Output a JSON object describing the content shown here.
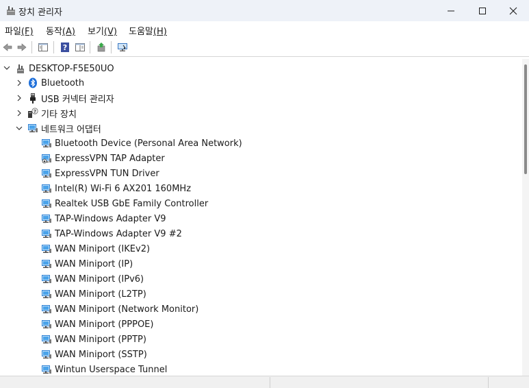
{
  "window": {
    "title": "장치 관리자",
    "icon": "device-manager-icon"
  },
  "controls": {
    "minimize_icon": "minimize-icon",
    "maximize_icon": "maximize-icon",
    "close_icon": "close-icon"
  },
  "menu": {
    "file": {
      "text": "파일",
      "accel": "(F)"
    },
    "action": {
      "text": "동작",
      "accel": "(A)"
    },
    "view": {
      "text": "보기",
      "accel": "(V)"
    },
    "help": {
      "text": "도움말",
      "accel": "(H)"
    }
  },
  "toolbar": {
    "back": "back-arrow-icon",
    "forward": "forward-arrow-icon",
    "properties": "properties-icon",
    "help": "help-icon",
    "show_hide": "show-hide-console-tree-icon",
    "update_driver": "update-driver-icon",
    "scan": "scan-hardware-icon"
  },
  "tree": {
    "root": {
      "label": "DESKTOP-F5E50UO",
      "expanded": true
    },
    "categories": [
      {
        "label": "Bluetooth",
        "expanded": false,
        "icon": "bluetooth-icon"
      },
      {
        "label": "USB 커넥터 관리자",
        "expanded": false,
        "icon": "usb-connector-icon"
      },
      {
        "label": "기타 장치",
        "expanded": false,
        "icon": "other-devices-icon"
      },
      {
        "label": "네트워크 어댑터",
        "expanded": true,
        "icon": "network-adapter-icon"
      }
    ],
    "adapters": [
      "Bluetooth Device (Personal Area Network)",
      "ExpressVPN TAP Adapter",
      "ExpressVPN TUN Driver",
      "Intel(R) Wi-Fi 6 AX201 160MHz",
      "Realtek USB GbE Family Controller",
      "TAP-Windows Adapter V9",
      "TAP-Windows Adapter V9 #2",
      "WAN Miniport (IKEv2)",
      "WAN Miniport (IP)",
      "WAN Miniport (IPv6)",
      "WAN Miniport (L2TP)",
      "WAN Miniport (Network Monitor)",
      "WAN Miniport (PPPOE)",
      "WAN Miniport (PPTP)",
      "WAN Miniport (SSTP)",
      "Wintun Userspace Tunnel"
    ]
  }
}
